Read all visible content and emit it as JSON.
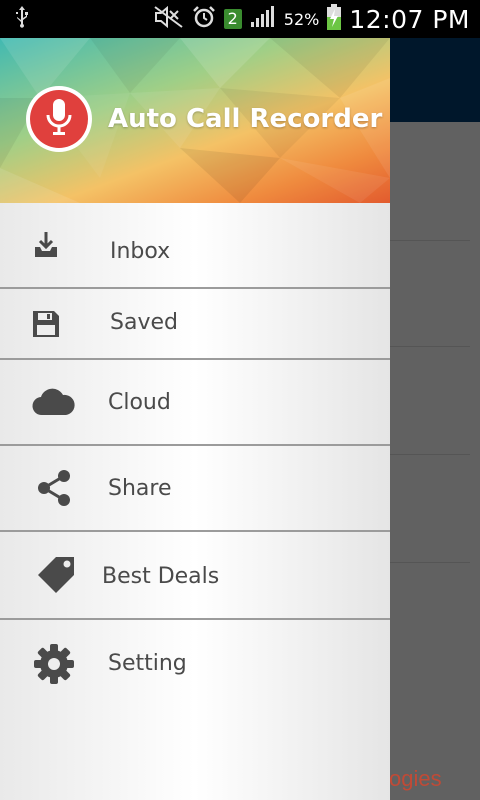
{
  "status_bar": {
    "left_icons": [
      "usb-icon"
    ],
    "right_icons": [
      "mute-icon",
      "alarm-icon",
      "notification-count-badge",
      "signal-icon",
      "battery-charging-icon"
    ],
    "notification_count": "2",
    "battery_percent": "52%",
    "time": "12:07 PM"
  },
  "drawer": {
    "app_title": "Auto Call Recorder",
    "logo_icon": "microphone-icon",
    "items": [
      {
        "label": "Inbox",
        "icon": "inbox-download-icon"
      },
      {
        "label": "Saved",
        "icon": "floppy-disk-icon"
      },
      {
        "label": "Cloud",
        "icon": "cloud-icon"
      },
      {
        "label": "Share",
        "icon": "share-icon"
      },
      {
        "label": "Best Deals",
        "icon": "tag-icon"
      },
      {
        "label": "Setting",
        "icon": "gear-icon"
      }
    ]
  },
  "background": {
    "partial_text": "ogies"
  },
  "colors": {
    "toolbar": "#003a6c",
    "logo_red": "#e0403d",
    "icon_gray": "#4a4a4a",
    "badge_green": "#3a8c2f"
  }
}
